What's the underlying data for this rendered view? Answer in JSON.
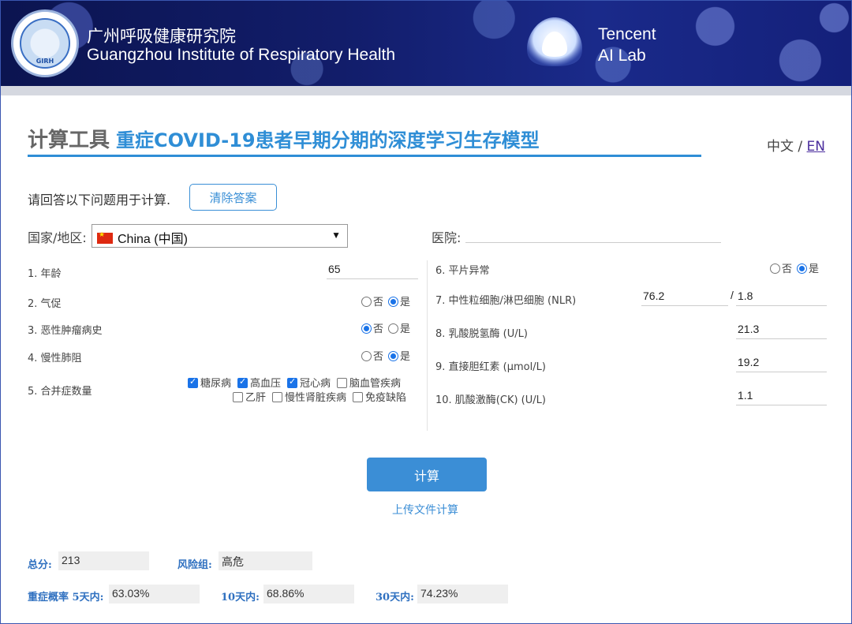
{
  "header": {
    "logo_text": "GIRH",
    "institute_cn": "广州呼吸健康研究院",
    "institute_en": "Guangzhou Institute of Respiratory Health",
    "partner_line1": "Tencent",
    "partner_line2": "AI Lab"
  },
  "title": {
    "main": "计算工具",
    "sub": "重症COVID-19患者早期分期的深度学习生存模型"
  },
  "lang": {
    "cn": "中文",
    "sep": " / ",
    "en": "EN"
  },
  "prompt": "请回答以下问题用于计算.",
  "clear_button": "清除答案",
  "country": {
    "label": "国家/地区:",
    "value": "China (中国)"
  },
  "hospital": {
    "label": "医院:",
    "value": ""
  },
  "left_questions": [
    {
      "label": "1. 年龄",
      "value": "65"
    },
    {
      "label": "2. 气促",
      "no": "否",
      "yes": "是",
      "selected": "yes"
    },
    {
      "label": "3. 恶性肿瘤病史",
      "no": "否",
      "yes": "是",
      "selected": "no"
    },
    {
      "label": "4. 慢性肺阻",
      "no": "否",
      "yes": "是",
      "selected": "yes"
    },
    {
      "label": "5. 合并症数量"
    }
  ],
  "comorbidities": [
    {
      "label": "糖尿病",
      "checked": true
    },
    {
      "label": "高血压",
      "checked": true
    },
    {
      "label": "冠心病",
      "checked": true
    },
    {
      "label": "脑血管疾病",
      "checked": false
    },
    {
      "label": "乙肝",
      "checked": false
    },
    {
      "label": "慢性肾脏疾病",
      "checked": false
    },
    {
      "label": "免疫缺陷",
      "checked": false
    }
  ],
  "right_questions": [
    {
      "label": "6. 平片异常",
      "no": "否",
      "yes": "是",
      "selected": "yes"
    },
    {
      "label": "7. 中性粒细胞/淋巴细胞 (NLR)",
      "value": "76.2",
      "value2": "1.8",
      "sep": "/"
    },
    {
      "label": "8. 乳酸脱氢酶 (U/L)",
      "value": "21.3"
    },
    {
      "label": "9. 直接胆红素 (μmol/L)",
      "value": "19.2"
    },
    {
      "label": "10. 肌酸激酶(CK) (U/L)",
      "value": "1.1"
    }
  ],
  "calc_button": "计算",
  "upload_link": "上传文件计算",
  "results": {
    "total_label": "总分:",
    "total_value": "213",
    "risk_label": "风险组:",
    "risk_value": "高危",
    "prob_label": "重症概率 5天内:",
    "prob5_value": "63.03%",
    "d10_label": "10天内:",
    "d10_value": "68.86%",
    "d30_label": "30天内:",
    "d30_value": "74.23%"
  },
  "colors": {
    "accent": "#2f8ed6",
    "button": "#3b8ed6",
    "radio_on": "#1a73e8"
  }
}
